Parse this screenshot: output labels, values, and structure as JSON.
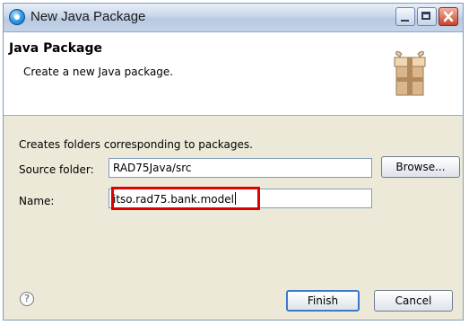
{
  "window": {
    "title": "New Java Package"
  },
  "header": {
    "title": "Java Package",
    "description": "Create a new Java package."
  },
  "body": {
    "info_text": "Creates folders corresponding to packages."
  },
  "form": {
    "source_folder": {
      "label": "Source folder:",
      "value": "RAD75Java/src"
    },
    "name": {
      "label": "Name:",
      "value": "itso.rad75.bank.model"
    },
    "browse_label": "Browse..."
  },
  "footer": {
    "help_glyph": "?",
    "finish_label": "Finish",
    "cancel_label": "Cancel"
  },
  "colors": {
    "highlight": "#e00000",
    "default_button_border": "#3d78c9"
  },
  "icons": {
    "app": "eclipse-app-icon",
    "header": "package-icon",
    "help": "help-icon"
  }
}
